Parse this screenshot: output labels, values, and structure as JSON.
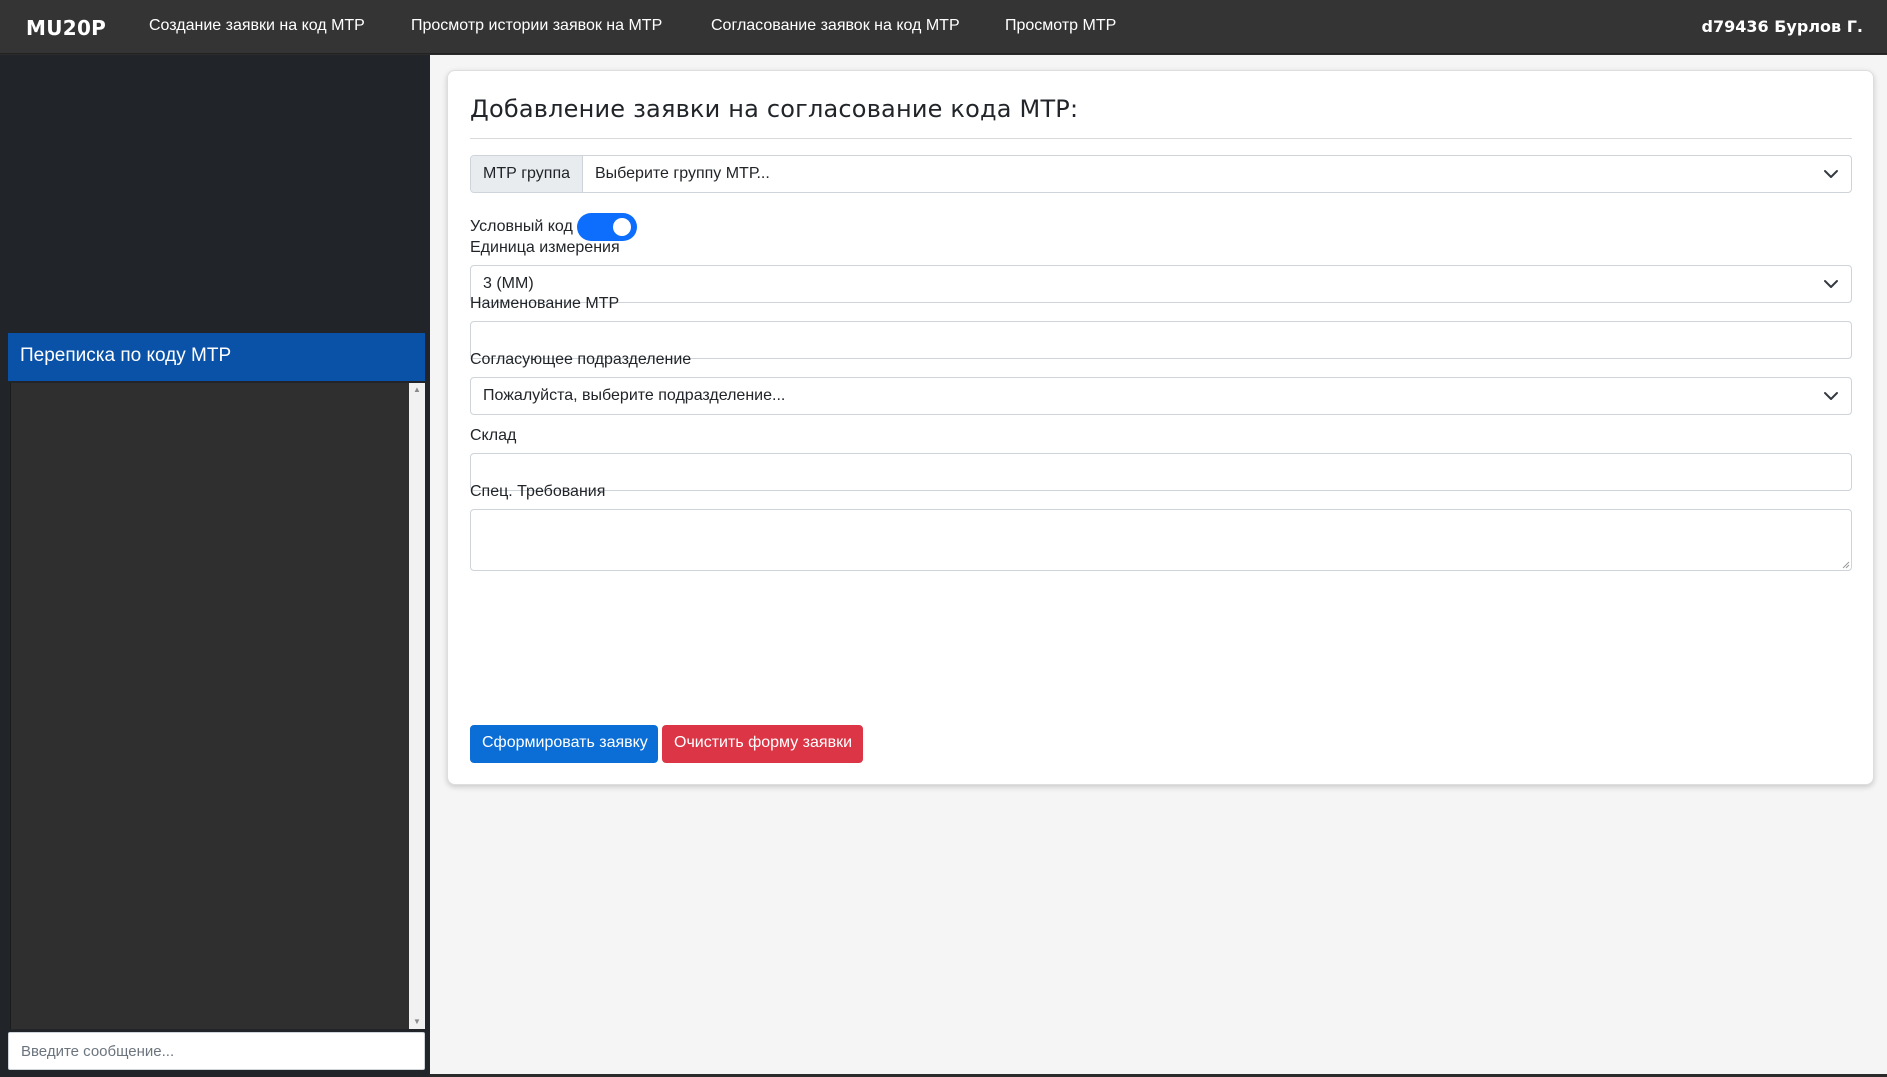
{
  "navbar": {
    "brand": "MU20P",
    "links": [
      "Создание заявки на код МТР",
      "Просмотр истории заявок на МТР",
      "Согласование заявок на код МТР",
      "Просмотр МТР"
    ],
    "user": "d79436 Бурлов Г."
  },
  "chat": {
    "title": "Переписка по коду МТР",
    "input_placeholder": "Введите сообщение..."
  },
  "form": {
    "title": "Добавление заявки на согласование кода МТР:",
    "group_label": "МТР группа",
    "group_placeholder": "Выберите группу МТР...",
    "conditional_code_label": "Условный код",
    "conditional_code_on": true,
    "unit_label": "Единица измерения",
    "unit_value": "3 (ММ)",
    "name_label": "Наименование МТР",
    "name_value": "",
    "department_label": "Согласующее подразделение",
    "department_placeholder": "Пожалуйста, выберите подразделение...",
    "warehouse_label": "Склад",
    "warehouse_value": "",
    "requirements_label": "Спец. Требования",
    "requirements_value": "",
    "submit_label": "Сформировать заявку",
    "clear_label": "Очистить форму заявки"
  },
  "colors": {
    "navbar_bg": "#343434",
    "sidebar_bg": "#212529",
    "chat_header_bg": "#0a52a8",
    "primary": "#0b6ed6",
    "danger": "#dc3545",
    "switch_on": "#0d6efd"
  },
  "icons": {
    "select_arrow": "chevron-down-icon",
    "scroll_up": "scroll-up-arrow-icon",
    "scroll_down": "scroll-down-arrow-icon",
    "resize": "resize-grip-icon"
  }
}
